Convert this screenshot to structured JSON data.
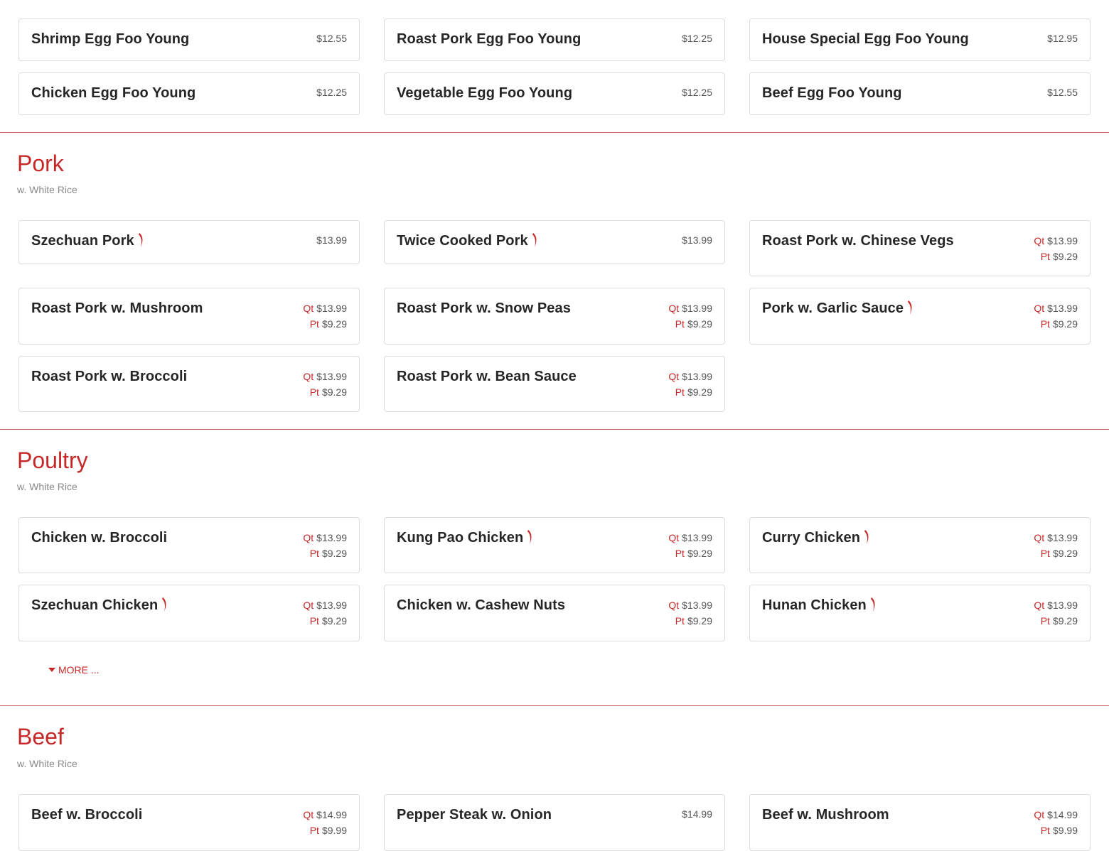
{
  "egg_foo_young": {
    "items": [
      {
        "name": "Shrimp Egg Foo Young",
        "price": "$12.55"
      },
      {
        "name": "Roast Pork Egg Foo Young",
        "price": "$12.25"
      },
      {
        "name": "House Special Egg Foo Young",
        "price": "$12.95"
      },
      {
        "name": "Chicken Egg Foo Young",
        "price": "$12.25"
      },
      {
        "name": "Vegetable Egg Foo Young",
        "price": "$12.25"
      },
      {
        "name": "Beef Egg Foo Young",
        "price": "$12.55"
      }
    ]
  },
  "labels": {
    "qt": "Qt",
    "pt": "Pt"
  },
  "pork": {
    "title": "Pork",
    "subtitle": "w. White Rice",
    "items": [
      {
        "name": "Szechuan Pork",
        "price": "$13.99",
        "spicy": true
      },
      {
        "name": "Twice Cooked Pork",
        "price": "$13.99",
        "spicy": true
      },
      {
        "name": "Roast Pork w. Chinese Vegs",
        "qt": "$13.99",
        "pt": "$9.29"
      },
      {
        "name": "Roast Pork w. Mushroom",
        "qt": "$13.99",
        "pt": "$9.29"
      },
      {
        "name": "Roast Pork w. Snow Peas",
        "qt": "$13.99",
        "pt": "$9.29"
      },
      {
        "name": "Pork w. Garlic Sauce",
        "qt": "$13.99",
        "pt": "$9.29",
        "spicy": true
      },
      {
        "name": "Roast Pork w. Broccoli",
        "qt": "$13.99",
        "pt": "$9.29"
      },
      {
        "name": "Roast Pork w. Bean Sauce",
        "qt": "$13.99",
        "pt": "$9.29"
      }
    ]
  },
  "poultry": {
    "title": "Poultry",
    "subtitle": "w. White Rice",
    "items": [
      {
        "name": "Chicken w. Broccoli",
        "qt": "$13.99",
        "pt": "$9.29"
      },
      {
        "name": "Kung Pao Chicken",
        "qt": "$13.99",
        "pt": "$9.29",
        "spicy": true
      },
      {
        "name": "Curry Chicken",
        "qt": "$13.99",
        "pt": "$9.29",
        "spicy": true
      },
      {
        "name": "Szechuan Chicken",
        "qt": "$13.99",
        "pt": "$9.29",
        "spicy": true
      },
      {
        "name": "Chicken w. Cashew Nuts",
        "qt": "$13.99",
        "pt": "$9.29"
      },
      {
        "name": "Hunan Chicken",
        "qt": "$13.99",
        "pt": "$9.29",
        "spicy": true
      }
    ],
    "more_label": "MORE ..."
  },
  "beef": {
    "title": "Beef",
    "subtitle": "w. White Rice",
    "items": [
      {
        "name": "Beef w. Broccoli",
        "qt": "$14.99",
        "pt": "$9.99"
      },
      {
        "name": "Pepper Steak w. Onion",
        "price": "$14.99"
      },
      {
        "name": "Beef w. Mushroom",
        "qt": "$14.99",
        "pt": "$9.99"
      }
    ]
  },
  "icons": {
    "spicy": "chili-pepper-icon",
    "more": "caret-down-icon"
  },
  "colors": {
    "accent": "#c62828",
    "border": "#dcdcdc",
    "divider": "#c86464"
  }
}
